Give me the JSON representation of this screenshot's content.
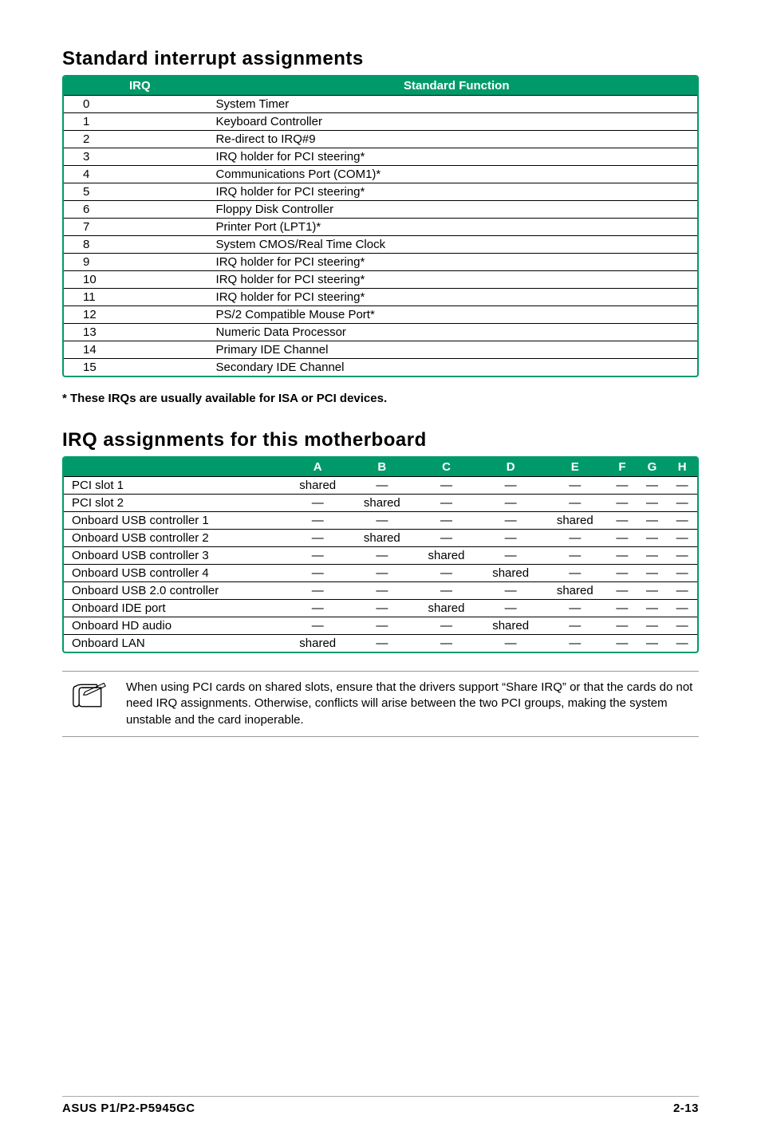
{
  "section1": {
    "title": "Standard interrupt assignments",
    "headers": {
      "irq": "IRQ",
      "fn": "Standard Function"
    },
    "rows": [
      {
        "irq": "0",
        "fn": "System Timer"
      },
      {
        "irq": "1",
        "fn": "Keyboard Controller"
      },
      {
        "irq": "2",
        "fn": "Re-direct to IRQ#9"
      },
      {
        "irq": "3",
        "fn": "IRQ holder for PCI steering*"
      },
      {
        "irq": "4",
        "fn": "Communications Port (COM1)*"
      },
      {
        "irq": "5",
        "fn": "IRQ holder for PCI steering*"
      },
      {
        "irq": "6",
        "fn": "Floppy Disk Controller"
      },
      {
        "irq": "7",
        "fn": "Printer Port (LPT1)*"
      },
      {
        "irq": "8",
        "fn": "System CMOS/Real Time Clock"
      },
      {
        "irq": "9",
        "fn": "IRQ holder for PCI steering*"
      },
      {
        "irq": "10",
        "fn": "IRQ holder for PCI steering*"
      },
      {
        "irq": "11",
        "fn": "IRQ holder for PCI steering*"
      },
      {
        "irq": "12",
        "fn": "PS/2 Compatible Mouse Port*"
      },
      {
        "irq": "13",
        "fn": "Numeric Data Processor"
      },
      {
        "irq": "14",
        "fn": "Primary IDE Channel"
      },
      {
        "irq": "15",
        "fn": "Secondary IDE Channel"
      }
    ]
  },
  "footnote": "* These IRQs are usually available for ISA or PCI devices.",
  "section2": {
    "title": "IRQ assignments for this motherboard",
    "cols": [
      "A",
      "B",
      "C",
      "D",
      "E",
      "F",
      "G",
      "H"
    ],
    "rows": [
      {
        "name": "PCI slot 1",
        "cells": [
          "shared",
          "—",
          "—",
          "—",
          "—",
          "—",
          "—",
          "—"
        ]
      },
      {
        "name": "PCI slot 2",
        "cells": [
          "—",
          "shared",
          "—",
          "—",
          "—",
          "—",
          "—",
          "—"
        ]
      },
      {
        "name": "Onboard USB controller 1",
        "cells": [
          "—",
          "—",
          "—",
          "—",
          "shared",
          "—",
          "—",
          "—"
        ]
      },
      {
        "name": "Onboard USB controller 2",
        "cells": [
          "—",
          "shared",
          "—",
          "—",
          "—",
          "—",
          "—",
          "—"
        ]
      },
      {
        "name": "Onboard USB controller 3",
        "cells": [
          "—",
          "—",
          "shared",
          "—",
          "—",
          "—",
          "—",
          "—"
        ]
      },
      {
        "name": "Onboard USB controller 4",
        "cells": [
          "—",
          "—",
          "—",
          "shared",
          "—",
          "—",
          "—",
          "—"
        ]
      },
      {
        "name": "Onboard USB 2.0 controller",
        "cells": [
          "—",
          "—",
          "—",
          "—",
          "shared",
          "—",
          "—",
          "—"
        ]
      },
      {
        "name": "Onboard IDE port",
        "cells": [
          "—",
          "—",
          "shared",
          "—",
          "—",
          "—",
          "—",
          "—"
        ]
      },
      {
        "name": "Onboard HD audio",
        "cells": [
          "—",
          "—",
          "—",
          "shared",
          "—",
          "—",
          "—",
          "—"
        ]
      },
      {
        "name": "Onboard LAN",
        "cells": [
          "shared",
          "—",
          "—",
          "—",
          "—",
          "—",
          "—",
          "—"
        ]
      }
    ]
  },
  "callout": "When using PCI cards on shared slots, ensure that the drivers support “Share IRQ” or that the cards do not need IRQ assignments. Otherwise, conflicts will arise between the two PCI groups, making the system unstable and the card inoperable.",
  "footer": {
    "left": "ASUS P1/P2-P5945GC",
    "right": "2-13"
  }
}
